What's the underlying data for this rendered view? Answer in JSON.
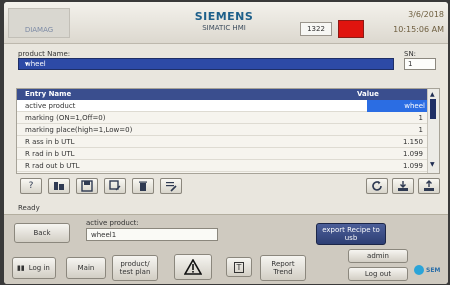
{
  "header": {
    "brand": "SIEMENS",
    "subtitle": "SIMATIC HMI",
    "code": "1322",
    "date": "3/6/2018",
    "time": "10:15:06 AM",
    "logo_text": "DIAMAG"
  },
  "product": {
    "label": "product Name:",
    "selected": "wheel",
    "sn_label": "SN:",
    "sn_value": "1"
  },
  "table": {
    "columns": [
      "Entry Name",
      "Value"
    ],
    "rows": [
      {
        "name": "active product",
        "value": "wheel"
      },
      {
        "name": "marking (ON=1,Off=0)",
        "value": "1"
      },
      {
        "name": "marking place(high=1,Low=0)",
        "value": "1"
      },
      {
        "name": "R ass in b UTL",
        "value": "1.150"
      },
      {
        "name": "R rad in b UTL",
        "value": "1.099"
      },
      {
        "name": "R rad out b UTL",
        "value": "1.099"
      }
    ]
  },
  "status": "Ready",
  "bottom": {
    "active_product_label": "active product:",
    "active_product_value": "wheel1",
    "back": "Back",
    "export": "export Recipe to usb",
    "log_in": "Log in",
    "main": "Main",
    "product_test_plan": "product/ test plan",
    "help": "T",
    "report_trend": "Report Trend",
    "admin": "admin",
    "log_out": "Log out",
    "logo_text": "SEM"
  },
  "colors": {
    "alarm": "#e0140f",
    "selection": "#2d4aa6",
    "highlight": "#2b6de3"
  }
}
